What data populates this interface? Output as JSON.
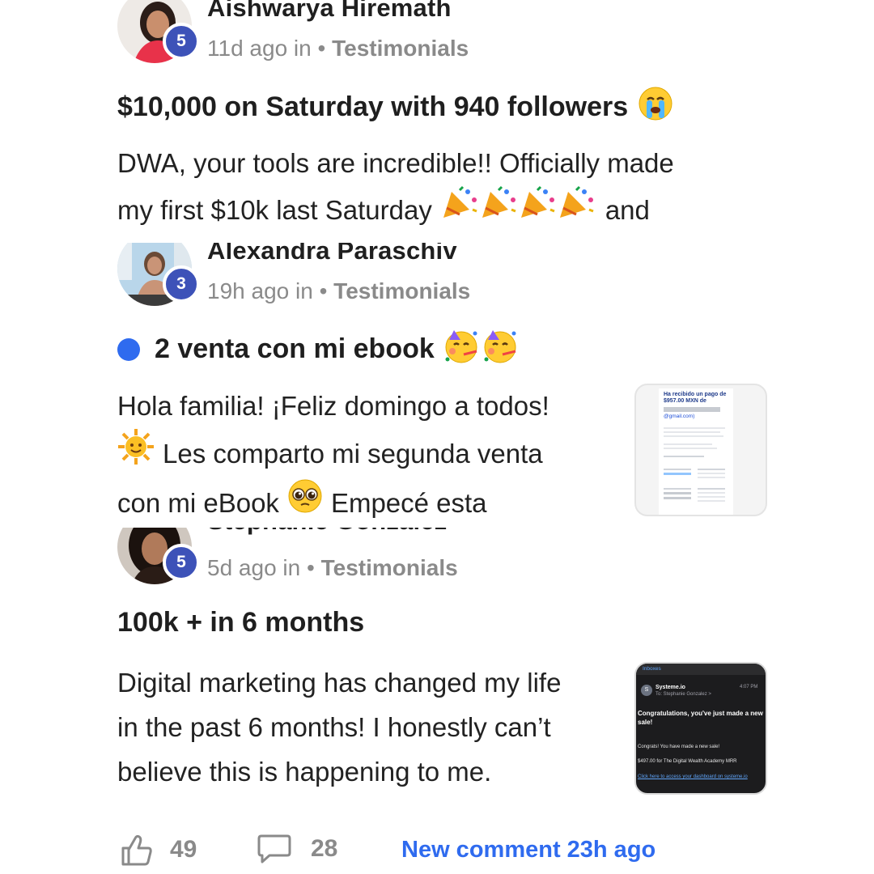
{
  "posts": [
    {
      "author": "Aishwarya Hiremath",
      "level": "5",
      "time": "11d ago in",
      "separator": "•",
      "category": "Testimonials",
      "title": "$10,000 on Saturday with 940 followers",
      "body_line1": "DWA, your tools are incredible!! Officially made",
      "body_line2a": "my first $10k last Saturday",
      "body_line2b": "and"
    },
    {
      "author": "Alexandra Paraschiv",
      "level": "3",
      "time": "19h ago in",
      "separator": "•",
      "category": "Testimonials",
      "title": "2 venta con mi ebook",
      "body_line1": "Hola familia! ¡Feliz domingo a todos!",
      "body_line2": "Les comparto mi segunda venta",
      "body_line3a": "con mi eBook",
      "body_line3b": "Empecé esta",
      "thumb": {
        "heading": "Ha recibido un pago de $957.00 MXN de",
        "email": "@gmail.com)"
      }
    },
    {
      "author": "Stephanie Gonzalez",
      "level": "5",
      "time": "5d ago in",
      "separator": "•",
      "category": "Testimonials",
      "title": "100k + in 6 months",
      "body_line1": "Digital marketing has changed my life",
      "body_line2": "in the past 6 months! I honestly can’t",
      "body_line3": "believe this is happening to me.",
      "thumb": {
        "folder": "Inboxes",
        "sender": "Systeme.io",
        "to": "To: Stephanie Gonzalez >",
        "clock": "4:07 PM",
        "subject": "Congratulations, you've just made a new sale!",
        "line1": "Congrats! You have made a new sale!",
        "line2": "$497.00 for The Digital Wealth Academy MRR",
        "link": "Click here to access your dashboard on systeme.io"
      }
    }
  ],
  "footer": {
    "likes": "49",
    "comments": "28",
    "new_comment": "New comment 23h ago"
  },
  "colors": {
    "badge": "#3d52b8",
    "accent_blue": "#2f6bef",
    "meta_gray": "#8a8a8a"
  },
  "icons": [
    "party-popper-icon",
    "sob-icon",
    "partying-face-icon",
    "sun-face-icon",
    "pleading-face-icon",
    "thumbs-up-icon",
    "comment-icon"
  ]
}
